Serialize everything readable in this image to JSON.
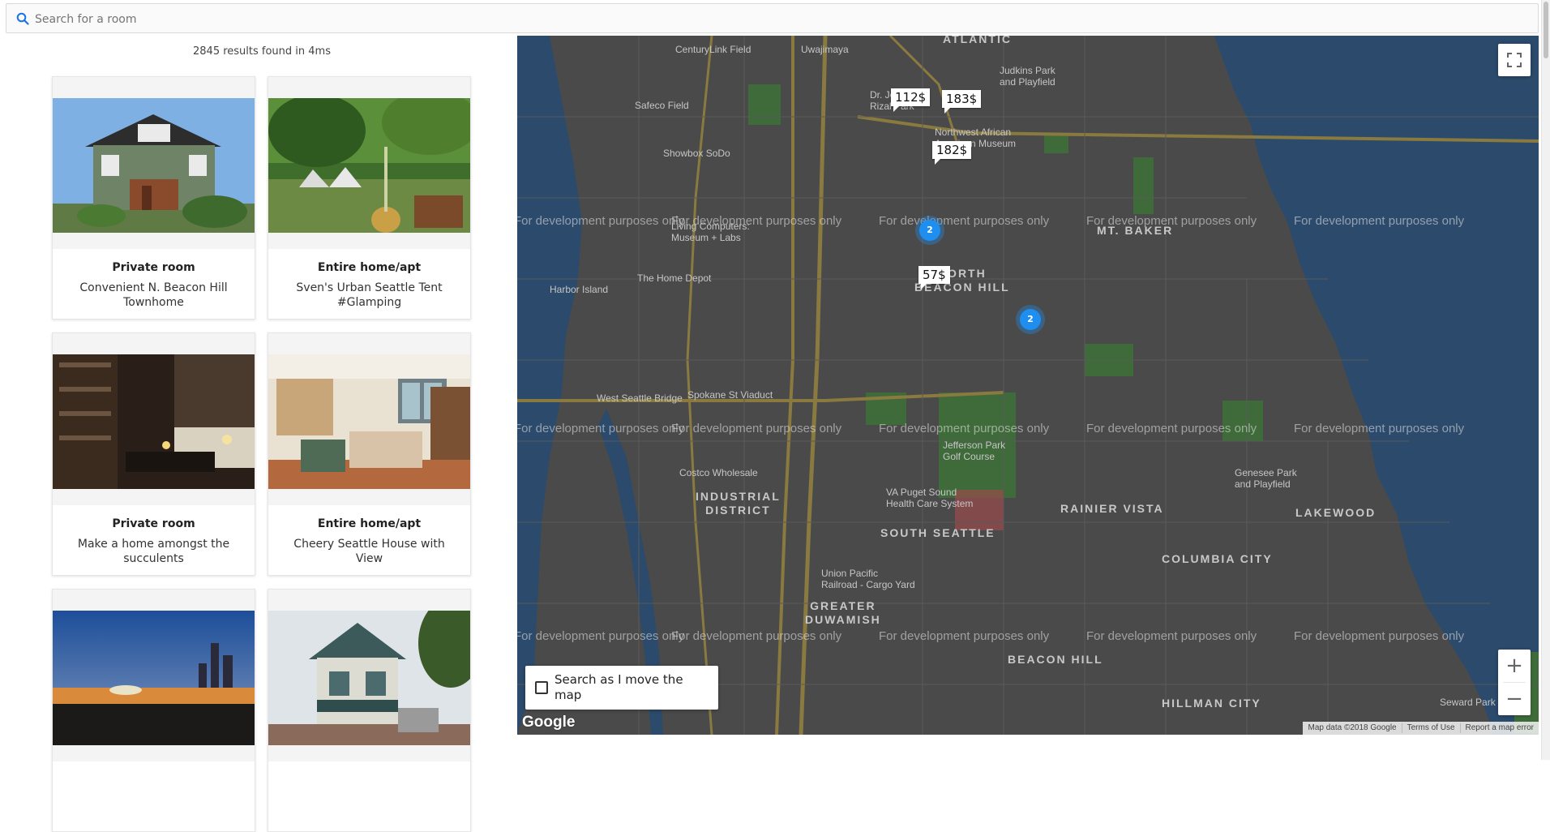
{
  "search": {
    "placeholder": "Search for a room",
    "icon": "search-icon"
  },
  "results_text": "2845 results found in 4ms",
  "listings": [
    {
      "type": "Private room",
      "title": "Convenient N. Beacon Hill Townhome"
    },
    {
      "type": "Entire home/apt",
      "title": "Sven's Urban Seattle Tent #Glamping"
    },
    {
      "type": "Private room",
      "title": "Make a home amongst the succulents"
    },
    {
      "type": "Entire home/apt",
      "title": "Cheery Seattle House with View"
    },
    {
      "type": "",
      "title": ""
    },
    {
      "type": "",
      "title": ""
    }
  ],
  "map": {
    "watermark": "For development purposes only",
    "prices": [
      "112$",
      "183$",
      "182$",
      "57$"
    ],
    "clusters": [
      "2",
      "2"
    ],
    "districts": {
      "atlantic": "ATLANTIC",
      "mt_baker": "MT. BAKER",
      "north_beacon_hill": "NORTH\nBEACON HILL",
      "industrial_district": "INDUSTRIAL\nDISTRICT",
      "rainier_vista": "RAINIER VISTA",
      "lakewood": "LAKEWOOD",
      "south_seattle": "SOUTH SEATTLE",
      "columbia_city": "COLUMBIA CITY",
      "greater_duwamish": "GREATER\nDUWAMISH",
      "beacon_hill": "BEACON HILL",
      "hillman_city": "HILLMAN CITY"
    },
    "pois": {
      "centurylink": "CenturyLink Field",
      "uwajimaya": "Uwajimaya",
      "judkins": "Judkins Park\nand Playfield",
      "safeco": "Safeco Field",
      "nw_african": "Northwest African\nAmerican Museum",
      "showbox": "Showbox SoDo",
      "living_computers": "Living Computers:\nMuseum + Labs",
      "harbor_island": "Harbor Island",
      "home_depot": "The Home Depot",
      "spokane_viaduct": "Spokane St Viaduct",
      "west_seattle_bridge": "West Seattle Bridge",
      "jefferson_park": "Jefferson Park\nGolf Course",
      "costco": "Costco Wholesale",
      "va_puget": "VA Puget Sound\nHealth Care System",
      "genesee_park": "Genesee Park\nand Playfield",
      "union_pacific": "Union Pacific\nRailroad - Cargo Yard",
      "seward_park": "Seward Park",
      "dri_park": "Dr. Jose\nRizal Park"
    },
    "search_as_move_label": "Search as I move the map",
    "search_as_move_checked": false,
    "google_logo": "Google",
    "attribution": [
      "Map data ©2018 Google",
      "Terms of Use",
      "Report a map error"
    ],
    "zoom_in": "+",
    "zoom_out": "−"
  }
}
